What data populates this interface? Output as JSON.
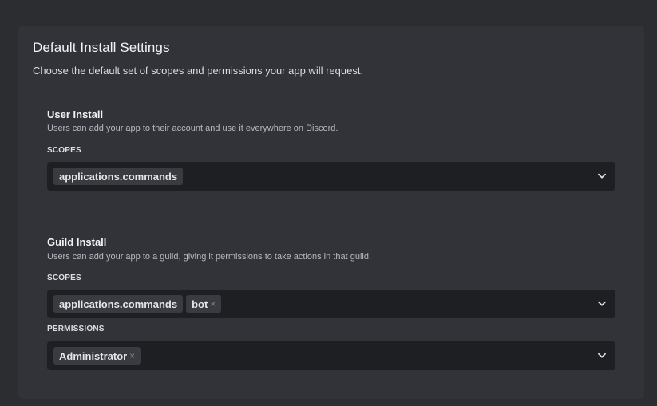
{
  "panel": {
    "title": "Default Install Settings",
    "description": "Choose the default set of scopes and permissions your app will request."
  },
  "user_install": {
    "title": "User Install",
    "description": "Users can add your app to their account and use it everywhere on Discord.",
    "scopes_label": "SCOPES",
    "scopes": [
      "applications.commands"
    ]
  },
  "guild_install": {
    "title": "Guild Install",
    "description": "Users can add your app to a guild, giving it permissions to take actions in that guild.",
    "scopes_label": "SCOPES",
    "scopes": [
      "applications.commands",
      "bot"
    ],
    "permissions_label": "PERMISSIONS",
    "permissions": [
      "Administrator"
    ]
  },
  "icons": {
    "dropdown": "chevron-down-icon",
    "remove": "close-icon",
    "remove_glyph": "×"
  }
}
